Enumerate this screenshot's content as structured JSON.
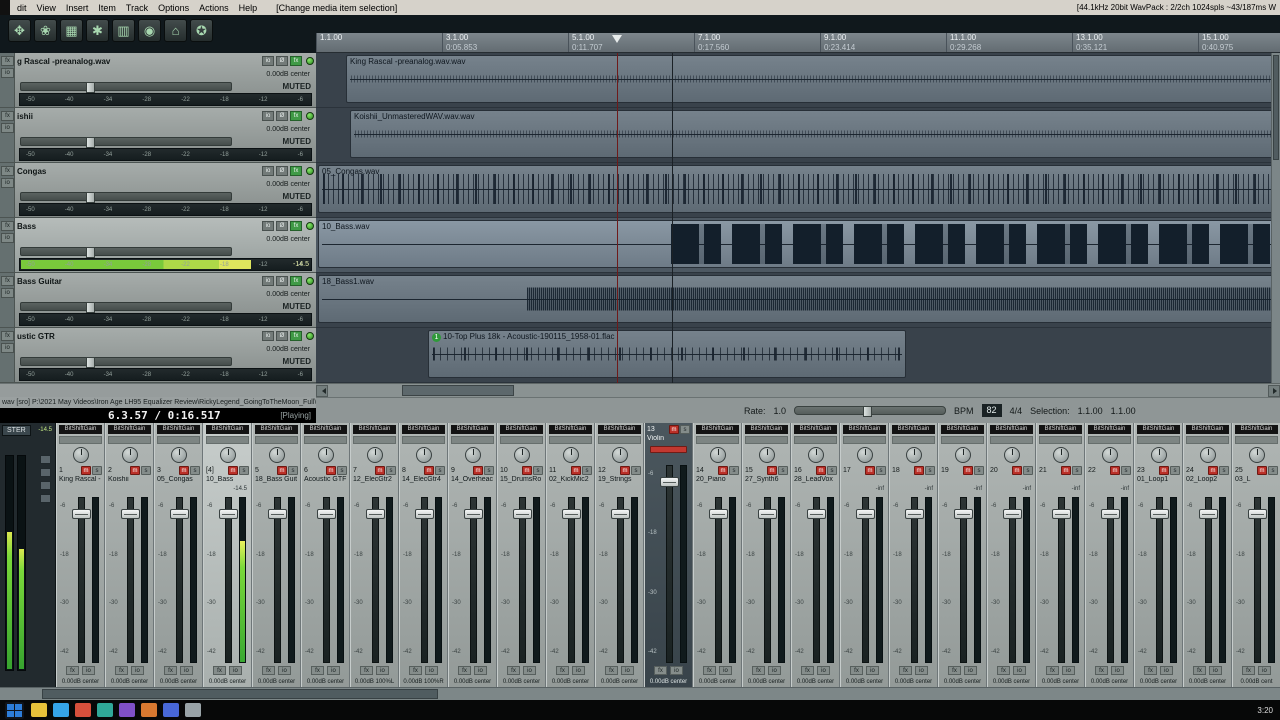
{
  "menu": {
    "items": [
      "dit",
      "View",
      "Insert",
      "Item",
      "Track",
      "Options",
      "Actions",
      "Help"
    ],
    "status": "[Change media item selection]",
    "right_info": "[44.1kHz 20bit WavPack : 2/2ch 1024spls ~43/187ms W"
  },
  "toolbar": {
    "icons": [
      {
        "glyph": "✥",
        "name": "move-tool"
      },
      {
        "glyph": "❀",
        "name": "envelope-tool"
      },
      {
        "glyph": "▦",
        "name": "grid-toggle"
      },
      {
        "glyph": "✱",
        "name": "snap-toggle"
      },
      {
        "glyph": "▥",
        "name": "item-grouping"
      },
      {
        "glyph": "◉",
        "name": "metronome"
      },
      {
        "glyph": "⌂",
        "name": "home-view"
      },
      {
        "glyph": "✪",
        "name": "lock-toggle"
      }
    ]
  },
  "ruler": {
    "ticks": [
      {
        "bar": "1.1.00",
        "time": ""
      },
      {
        "bar": "3.1.00",
        "time": "0:05.853"
      },
      {
        "bar": "5.1.00",
        "time": "0:11.707"
      },
      {
        "bar": "7.1.00",
        "time": "0:17.560"
      },
      {
        "bar": "9.1.00",
        "time": "0:23.414"
      },
      {
        "bar": "11.1.00",
        "time": "0:29.268"
      },
      {
        "bar": "13.1.00",
        "time": "0:35.121"
      },
      {
        "bar": "15.1.00",
        "time": "0:40.975"
      }
    ]
  },
  "tcp": {
    "btn_io": "io",
    "btn_phase": "Ø",
    "btn_fx": "fx",
    "meter_scale": [
      "-50",
      "-40",
      "-34",
      "-28",
      "-22",
      "-18",
      "-12",
      "-6"
    ]
  },
  "tracks": [
    {
      "name": "g Rascal -preanalog.wav",
      "vol": "0.00dB center",
      "mute_label": "MUTED",
      "item_label": "King Rascal -preanalog.wav.wav"
    },
    {
      "name": "ishii",
      "vol": "0.00dB center",
      "mute_label": "MUTED",
      "item_label": "Koishii_UnmasteredWAV.wav.wav"
    },
    {
      "name": "Congas",
      "vol": "0.00dB center",
      "mute_label": "MUTED",
      "item_label": "05_Congas.wav"
    },
    {
      "name": "Bass",
      "vol": "0.00dB center",
      "mute_label": "",
      "peak": "-14.5",
      "selected": true,
      "item_label": "10_Bass.wav"
    },
    {
      "name": "Bass Guitar",
      "vol": "0.00dB center",
      "mute_label": "MUTED",
      "item_label": "18_Bass1.wav"
    },
    {
      "name": "ustic GTR",
      "vol": "0.00dB center",
      "mute_label": "MUTED",
      "badge": "1",
      "item_label": "10-Top Plus 18k - Acoustic-190115_1958-01.flac"
    }
  ],
  "status": {
    "path": "wav [sro] P:\\2021 May Videos\\Iron Age LH95 Equalizer Review\\RickyLegend_GoingToTheMoon_Full\\10_Bas",
    "time": "6.3.57 / 0:16.517",
    "state": "[Playing]"
  },
  "transport": {
    "rate_label": "Rate:",
    "rate": "1.0",
    "bpm_label": "BPM",
    "bpm": "82",
    "timesig": "4/4",
    "sel_label": "Selection:",
    "sel_a": "1.1.00",
    "sel_b": "1.1.00"
  },
  "mixer": {
    "m": "m",
    "s": "s",
    "scale": [
      "-6",
      "-18",
      "-30",
      "-42"
    ],
    "master": {
      "label": "STER",
      "peak": "-14.5"
    },
    "strips": [
      {
        "num": "1",
        "fx": "BitShiftGain",
        "name": "King Rascal -",
        "vol": "0.00dB center"
      },
      {
        "num": "2",
        "fx": "BitShiftGain",
        "name": "Koishii",
        "vol": "0.00dB center"
      },
      {
        "num": "3",
        "fx": "BitShiftGain",
        "name": "05_Congas",
        "vol": "0.00dB center"
      },
      {
        "num": "[4]",
        "fx": "BitShiftGain",
        "name": "10_Bass",
        "vol": "0.00dB center",
        "peak": "-14.5",
        "selected": true
      },
      {
        "num": "5",
        "fx": "BitShiftGain",
        "name": "18_Bass Guit",
        "vol": "0.00dB center"
      },
      {
        "num": "6",
        "fx": "BitShiftGain",
        "name": "Acoustic GTF",
        "vol": "0.00dB center"
      },
      {
        "num": "7",
        "fx": "BitShiftGain",
        "name": "12_ElecGtr2",
        "vol": "0.00dB 100%L"
      },
      {
        "num": "8",
        "fx": "BitShiftGain",
        "name": "14_ElecGtr4",
        "vol": "0.00dB 100%R"
      },
      {
        "num": "9",
        "fx": "BitShiftGain",
        "name": "14_Overheac",
        "vol": "0.00dB center"
      },
      {
        "num": "10",
        "fx": "BitShiftGain",
        "name": "15_DrumsRo",
        "vol": "0.00dB center"
      },
      {
        "num": "11",
        "fx": "BitShiftGain",
        "name": "02_KickMic2",
        "vol": "0.00dB center"
      },
      {
        "num": "12",
        "fx": "BitShiftGain",
        "name": "19_Strings",
        "vol": "0.00dB center"
      },
      {
        "num": "13",
        "name": "Violin",
        "vol": "0.00dB center",
        "tall": true,
        "muted": true
      },
      {
        "num": "14",
        "fx": "BitShiftGain",
        "name": "20_Piano",
        "vol": "0.00dB center"
      },
      {
        "num": "15",
        "fx": "BitShiftGain",
        "name": "27_Synth6",
        "vol": "0.00dB center"
      },
      {
        "num": "16",
        "fx": "BitShiftGain",
        "name": "28_LeadVox",
        "vol": "0.00dB center"
      },
      {
        "num": "17",
        "fx": "BitShiftGain",
        "name": "",
        "peak": "-inf",
        "vol": "0.00dB center"
      },
      {
        "num": "18",
        "fx": "BitShiftGain",
        "name": "",
        "peak": "-inf",
        "vol": "0.00dB center"
      },
      {
        "num": "19",
        "fx": "BitShiftGain",
        "name": "",
        "peak": "-inf",
        "vol": "0.00dB center"
      },
      {
        "num": "20",
        "fx": "BitShiftGain",
        "name": "",
        "peak": "-inf",
        "vol": "0.00dB center"
      },
      {
        "num": "21",
        "fx": "BitShiftGain",
        "name": "",
        "peak": "-inf",
        "vol": "0.00dB center"
      },
      {
        "num": "22",
        "fx": "BitShiftGain",
        "name": "",
        "peak": "-inf",
        "vol": "0.00dB center"
      },
      {
        "num": "23",
        "fx": "BitShiftGain",
        "name": "01_Loop1",
        "vol": "0.00dB center"
      },
      {
        "num": "24",
        "fx": "BitShiftGain",
        "name": "02_Loop2",
        "vol": "0.00dB center"
      },
      {
        "num": "25",
        "fx": "BitShiftGain",
        "name": "03_L",
        "vol": "0.00dB cent"
      }
    ]
  },
  "taskbar": {
    "clock": "3:20",
    "icons": [
      {
        "c": "#e8c23a",
        "name": "folder-app"
      },
      {
        "c": "#35a4e8",
        "name": "browser-app"
      },
      {
        "c": "#d8503c",
        "name": "media-app"
      },
      {
        "c": "#30a898",
        "name": "utility-app"
      },
      {
        "c": "#8050c8",
        "name": "chat-app"
      },
      {
        "c": "#d87830",
        "name": "editor-app"
      },
      {
        "c": "#4868d8",
        "name": "mail-app"
      },
      {
        "c": "#9aa4a8",
        "name": "settings-app"
      }
    ]
  }
}
